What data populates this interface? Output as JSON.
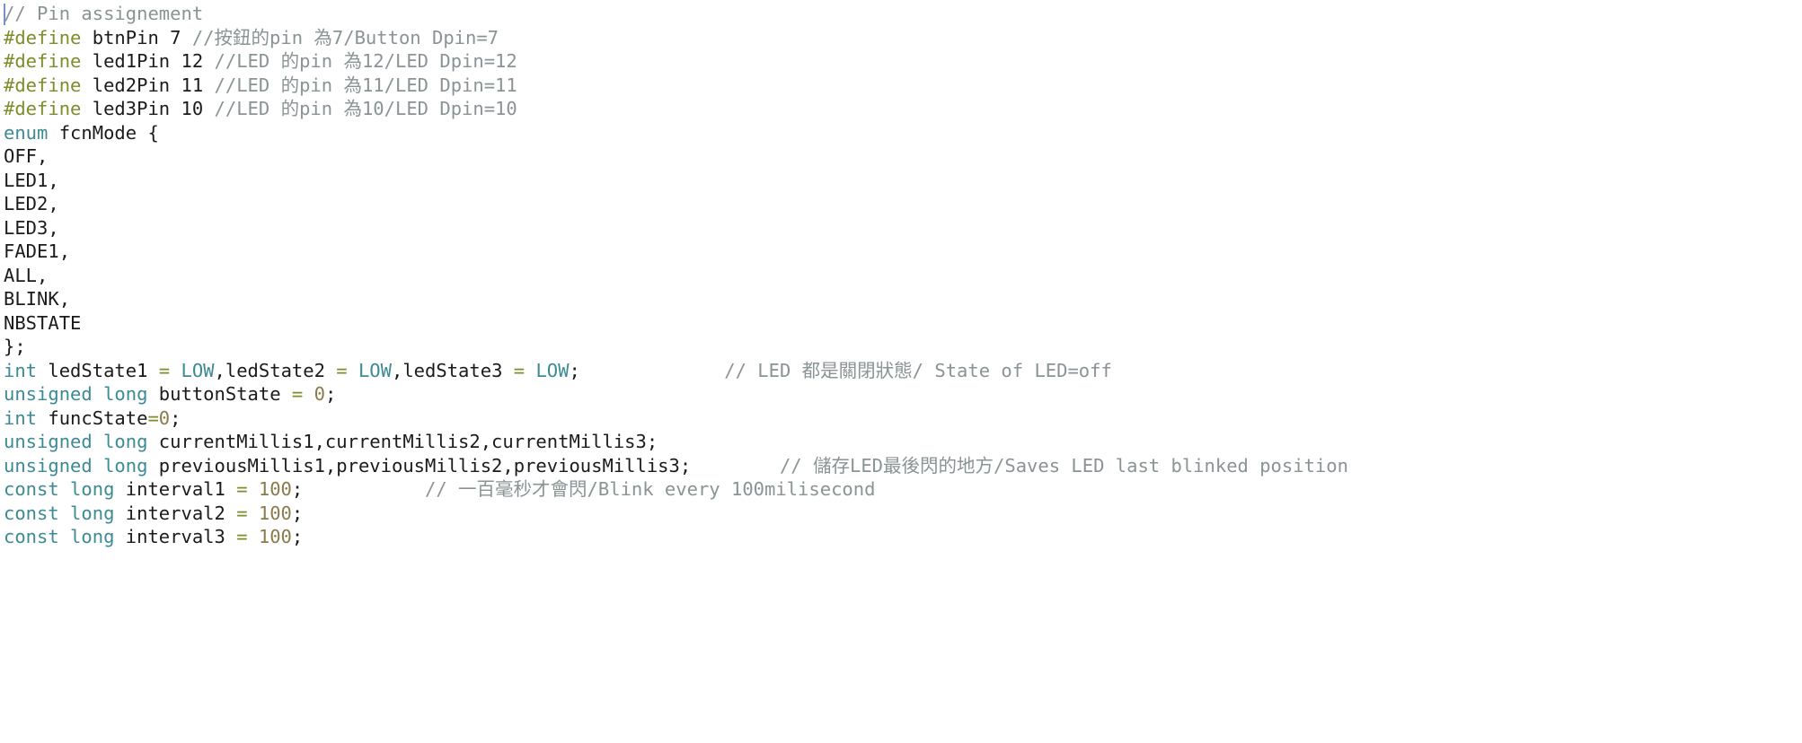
{
  "editor": {
    "theme": "arduino-light",
    "language": "cpp",
    "background_color": "#ffffff",
    "caret_color": "#7a8ec9",
    "colors": {
      "comment": "#8a9395",
      "preprocessor": "#7e8c2a",
      "keyword": "#3c8b94",
      "constant": "#3c8b94",
      "operator": "#7e8c2a",
      "number": "#8a7b4a",
      "plain": "#1b1b1b"
    }
  },
  "lines": [
    {
      "n": 1,
      "tokens": [
        {
          "t": "comment",
          "s": "// Pin assignement"
        }
      ]
    },
    {
      "n": 2,
      "tokens": [
        {
          "t": "preproc",
          "s": "#define"
        },
        {
          "t": "plain",
          "s": " btnPin "
        },
        {
          "t": "plain",
          "s": "7"
        },
        {
          "t": "plain",
          "s": " "
        },
        {
          "t": "comment",
          "s": "//按鈕的pin 為7/Button Dpin=7"
        }
      ]
    },
    {
      "n": 3,
      "tokens": [
        {
          "t": "preproc",
          "s": "#define"
        },
        {
          "t": "plain",
          "s": " led1Pin "
        },
        {
          "t": "plain",
          "s": "12"
        },
        {
          "t": "plain",
          "s": " "
        },
        {
          "t": "comment",
          "s": "//LED 的pin 為12/LED Dpin=12"
        }
      ]
    },
    {
      "n": 4,
      "tokens": [
        {
          "t": "preproc",
          "s": "#define"
        },
        {
          "t": "plain",
          "s": " led2Pin "
        },
        {
          "t": "plain",
          "s": "11"
        },
        {
          "t": "plain",
          "s": " "
        },
        {
          "t": "comment",
          "s": "//LED 的pin 為11/LED Dpin=11"
        }
      ]
    },
    {
      "n": 5,
      "tokens": [
        {
          "t": "preproc",
          "s": "#define"
        },
        {
          "t": "plain",
          "s": " led3Pin "
        },
        {
          "t": "plain",
          "s": "10"
        },
        {
          "t": "plain",
          "s": " "
        },
        {
          "t": "comment",
          "s": "//LED 的pin 為10/LED Dpin=10"
        }
      ]
    },
    {
      "n": 6,
      "tokens": [
        {
          "t": "keyword",
          "s": "enum"
        },
        {
          "t": "plain",
          "s": " fcnMode {"
        }
      ]
    },
    {
      "n": 7,
      "tokens": [
        {
          "t": "plain",
          "s": "OFF,"
        }
      ]
    },
    {
      "n": 8,
      "tokens": [
        {
          "t": "plain",
          "s": "LED1,"
        }
      ]
    },
    {
      "n": 9,
      "tokens": [
        {
          "t": "plain",
          "s": "LED2,"
        }
      ]
    },
    {
      "n": 10,
      "tokens": [
        {
          "t": "plain",
          "s": "LED3,"
        }
      ]
    },
    {
      "n": 11,
      "tokens": [
        {
          "t": "plain",
          "s": "FADE1,"
        }
      ]
    },
    {
      "n": 12,
      "tokens": [
        {
          "t": "plain",
          "s": "ALL,"
        }
      ]
    },
    {
      "n": 13,
      "tokens": [
        {
          "t": "plain",
          "s": "BLINK,"
        }
      ]
    },
    {
      "n": 14,
      "tokens": [
        {
          "t": "plain",
          "s": "NBSTATE"
        }
      ]
    },
    {
      "n": 15,
      "tokens": [
        {
          "t": "plain",
          "s": "};"
        }
      ]
    },
    {
      "n": 16,
      "tokens": [
        {
          "t": "keyword",
          "s": "int"
        },
        {
          "t": "plain",
          "s": " ledState1 "
        },
        {
          "t": "operator",
          "s": "="
        },
        {
          "t": "plain",
          "s": " "
        },
        {
          "t": "constant",
          "s": "LOW"
        },
        {
          "t": "plain",
          "s": ",ledState2 "
        },
        {
          "t": "operator",
          "s": "="
        },
        {
          "t": "plain",
          "s": " "
        },
        {
          "t": "constant",
          "s": "LOW"
        },
        {
          "t": "plain",
          "s": ",ledState3 "
        },
        {
          "t": "operator",
          "s": "="
        },
        {
          "t": "plain",
          "s": " "
        },
        {
          "t": "constant",
          "s": "LOW"
        },
        {
          "t": "plain",
          "s": ";             "
        },
        {
          "t": "comment",
          "s": "// LED 都是關閉狀態/ State of LED=off"
        }
      ]
    },
    {
      "n": 17,
      "tokens": [
        {
          "t": "keyword",
          "s": "unsigned long"
        },
        {
          "t": "plain",
          "s": " buttonState "
        },
        {
          "t": "operator",
          "s": "="
        },
        {
          "t": "plain",
          "s": " "
        },
        {
          "t": "number",
          "s": "0"
        },
        {
          "t": "plain",
          "s": ";"
        }
      ]
    },
    {
      "n": 18,
      "tokens": [
        {
          "t": "keyword",
          "s": "int"
        },
        {
          "t": "plain",
          "s": " funcState"
        },
        {
          "t": "operator",
          "s": "="
        },
        {
          "t": "number",
          "s": "0"
        },
        {
          "t": "plain",
          "s": ";"
        }
      ]
    },
    {
      "n": 19,
      "tokens": [
        {
          "t": "keyword",
          "s": "unsigned long"
        },
        {
          "t": "plain",
          "s": " currentMillis1,currentMillis2,currentMillis3;"
        }
      ]
    },
    {
      "n": 20,
      "tokens": [
        {
          "t": "keyword",
          "s": "unsigned long"
        },
        {
          "t": "plain",
          "s": " previousMillis1,previousMillis2,previousMillis3;        "
        },
        {
          "t": "comment",
          "s": "// 儲存LED最後閃的地方/Saves LED last blinked position"
        }
      ]
    },
    {
      "n": 21,
      "tokens": [
        {
          "t": "keyword",
          "s": "const long"
        },
        {
          "t": "plain",
          "s": " interval1 "
        },
        {
          "t": "operator",
          "s": "="
        },
        {
          "t": "plain",
          "s": " "
        },
        {
          "t": "number",
          "s": "100"
        },
        {
          "t": "plain",
          "s": ";           "
        },
        {
          "t": "comment",
          "s": "// 一百毫秒才會閃/Blink every 100milisecond"
        }
      ]
    },
    {
      "n": 22,
      "tokens": [
        {
          "t": "keyword",
          "s": "const long"
        },
        {
          "t": "plain",
          "s": " interval2 "
        },
        {
          "t": "operator",
          "s": "="
        },
        {
          "t": "plain",
          "s": " "
        },
        {
          "t": "number",
          "s": "100"
        },
        {
          "t": "plain",
          "s": ";"
        }
      ]
    },
    {
      "n": 23,
      "tokens": [
        {
          "t": "keyword",
          "s": "const long"
        },
        {
          "t": "plain",
          "s": " interval3 "
        },
        {
          "t": "operator",
          "s": "="
        },
        {
          "t": "plain",
          "s": " "
        },
        {
          "t": "number",
          "s": "100"
        },
        {
          "t": "plain",
          "s": ";"
        }
      ]
    },
    {
      "n": 24,
      "tokens": []
    },
    {
      "n": 25,
      "tokens": []
    }
  ]
}
